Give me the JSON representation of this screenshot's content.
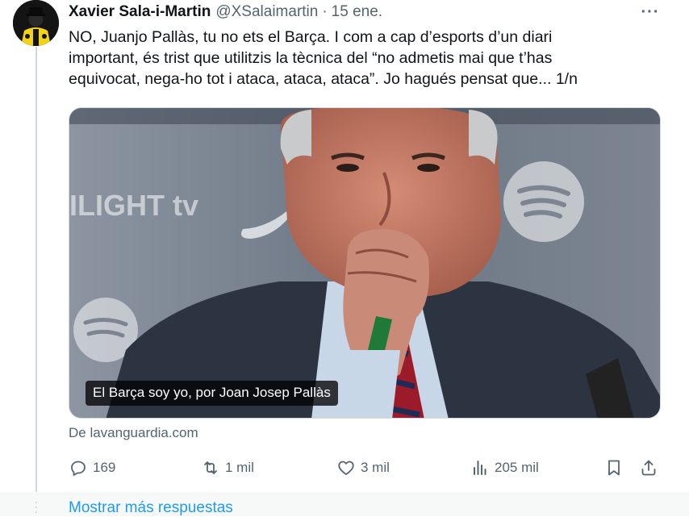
{
  "tweet": {
    "display_name": "Xavier Sala-i-Martin",
    "handle": "@XSalaimartin",
    "separator": "·",
    "date": "15 ene.",
    "more": "···",
    "text": "NO, Juanjo Pallàs, tu no ets el Barça. I com a cap d’esports d’un diari\nimportant, és trist que utilitzis la tècnica del “no admetis mai que t’has\nequivocat, nega-ho tot i ataca, ataca, ataca”. Jo hagués pensat que... 1/n"
  },
  "card": {
    "caption": "El Barça soy yo, por Joan Josep Pallàs",
    "backdrop_text": "ILIGHT tv",
    "source": "De lavanguardia.com"
  },
  "actions": {
    "reply": {
      "icon": "reply-icon",
      "count": "169"
    },
    "retweet": {
      "icon": "retweet-icon",
      "count": "1 mil"
    },
    "like": {
      "icon": "heart-icon",
      "count": "3 mil"
    },
    "views": {
      "icon": "views-icon",
      "count": "205 mil"
    },
    "bookmark": {
      "icon": "bookmark-icon"
    },
    "share": {
      "icon": "share-icon"
    }
  },
  "footer": {
    "more_replies": "Mostrar más respuestas"
  },
  "colors": {
    "text": "#0f1419",
    "secondary": "#536471",
    "link": "#1d9bf0",
    "border": "#cfd9de"
  }
}
